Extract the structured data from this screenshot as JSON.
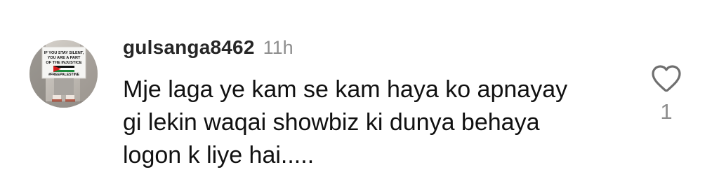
{
  "comment": {
    "username": "gulsanga8462",
    "timestamp": "11h",
    "text_lines": [
      "Mje laga ye kam se kam haya ko apnayay",
      "gi lekin waqai showbiz ki dunya behaya",
      "logon k liye hai....."
    ],
    "like_count": "1",
    "avatar_sign_lines": [
      "IF YOU STAY SILENT,",
      "YOU ARE A PART",
      "OF THE INJUSTICE",
      "#FREEPALESTINE"
    ]
  },
  "icons": {
    "like": "heart-outline-icon"
  },
  "colors": {
    "username": "#262626",
    "timestamp": "#8e8e8e",
    "text": "#111111",
    "like_icon": "#6f6f6f",
    "flag_red": "#d81e1e",
    "flag_green": "#1f8a3d",
    "flag_black": "#111111"
  }
}
